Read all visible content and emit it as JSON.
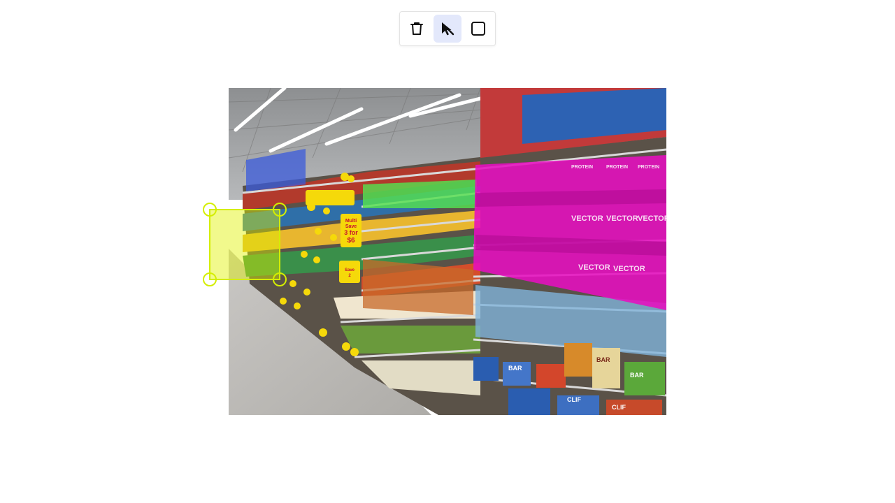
{
  "toolbar": {
    "tools": [
      {
        "id": "delete",
        "icon": "trash-icon",
        "active": false
      },
      {
        "id": "select",
        "icon": "cursor-arrow-icon",
        "active": true
      },
      {
        "id": "rectangle",
        "icon": "square-icon",
        "active": false
      }
    ]
  },
  "image": {
    "subject": "supermarket shelf aisle with colored segmentation masks",
    "shelf_sign_lines": [
      "Multi",
      "Save",
      "3 for",
      "$6"
    ],
    "shelf_sign2_lines": [
      "Save",
      "2"
    ],
    "product_labels": [
      "VECTOR",
      "VECTOR",
      "VECTOR",
      "VECTOR",
      "VECTOR",
      "PROTEIN",
      "PROTEIN",
      "PROTEIN",
      "CLIF",
      "CLIF",
      "BAR",
      "BAR",
      "BAR"
    ]
  },
  "annotations": [
    {
      "label": "selected-box",
      "color": "#d4ee00",
      "state": "selected"
    },
    {
      "label": "blue-region",
      "color": "#3b5bdb"
    },
    {
      "label": "yellow-tags",
      "color": "#f5d90a"
    },
    {
      "label": "green-region",
      "color": "#55e04f"
    },
    {
      "label": "orange-region",
      "color": "#c8692a"
    },
    {
      "label": "magenta-region",
      "color": "#e60fbf"
    },
    {
      "label": "lightblue-region",
      "color": "#7fb3d9"
    }
  ],
  "colors": {
    "accent": "#d4ee00",
    "active_tool_bg": "#e3e8fb"
  }
}
